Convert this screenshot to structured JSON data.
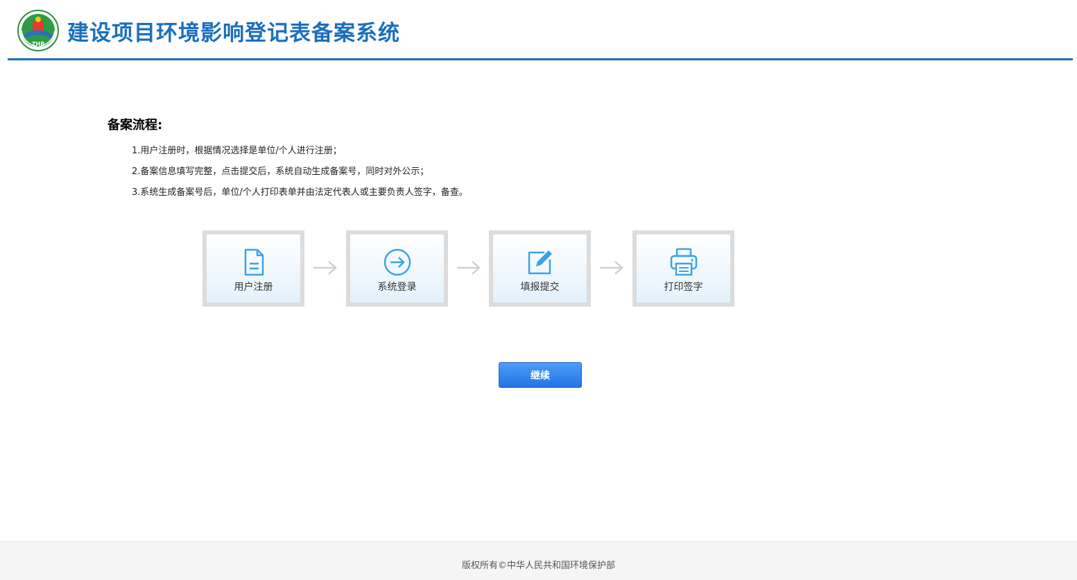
{
  "header": {
    "title": "建设项目环境影响登记表备案系统",
    "logo_text": "ZHB"
  },
  "process": {
    "heading": "备案流程:",
    "steps": [
      "1.用户注册时，根据情况选择是单位/个人进行注册；",
      "2.备案信息填写完整，点击提交后，系统自动生成备案号，同时对外公示；",
      "3.系统生成备案号后，单位/个人打印表单并由法定代表人或主要负责人签字，备查。"
    ]
  },
  "flow": [
    {
      "label": "用户注册",
      "icon": "document-icon"
    },
    {
      "label": "系统登录",
      "icon": "arrow-circle-icon"
    },
    {
      "label": "填报提交",
      "icon": "edit-icon"
    },
    {
      "label": "打印签字",
      "icon": "printer-icon"
    }
  ],
  "actions": {
    "continue_label": "继续"
  },
  "footer": {
    "copyright": "版权所有©中华人民共和国环境保护部"
  },
  "colors": {
    "brand_blue": "#1a6fbd",
    "icon_blue": "#3aa3e3",
    "button_blue": "#2a7ef0"
  }
}
